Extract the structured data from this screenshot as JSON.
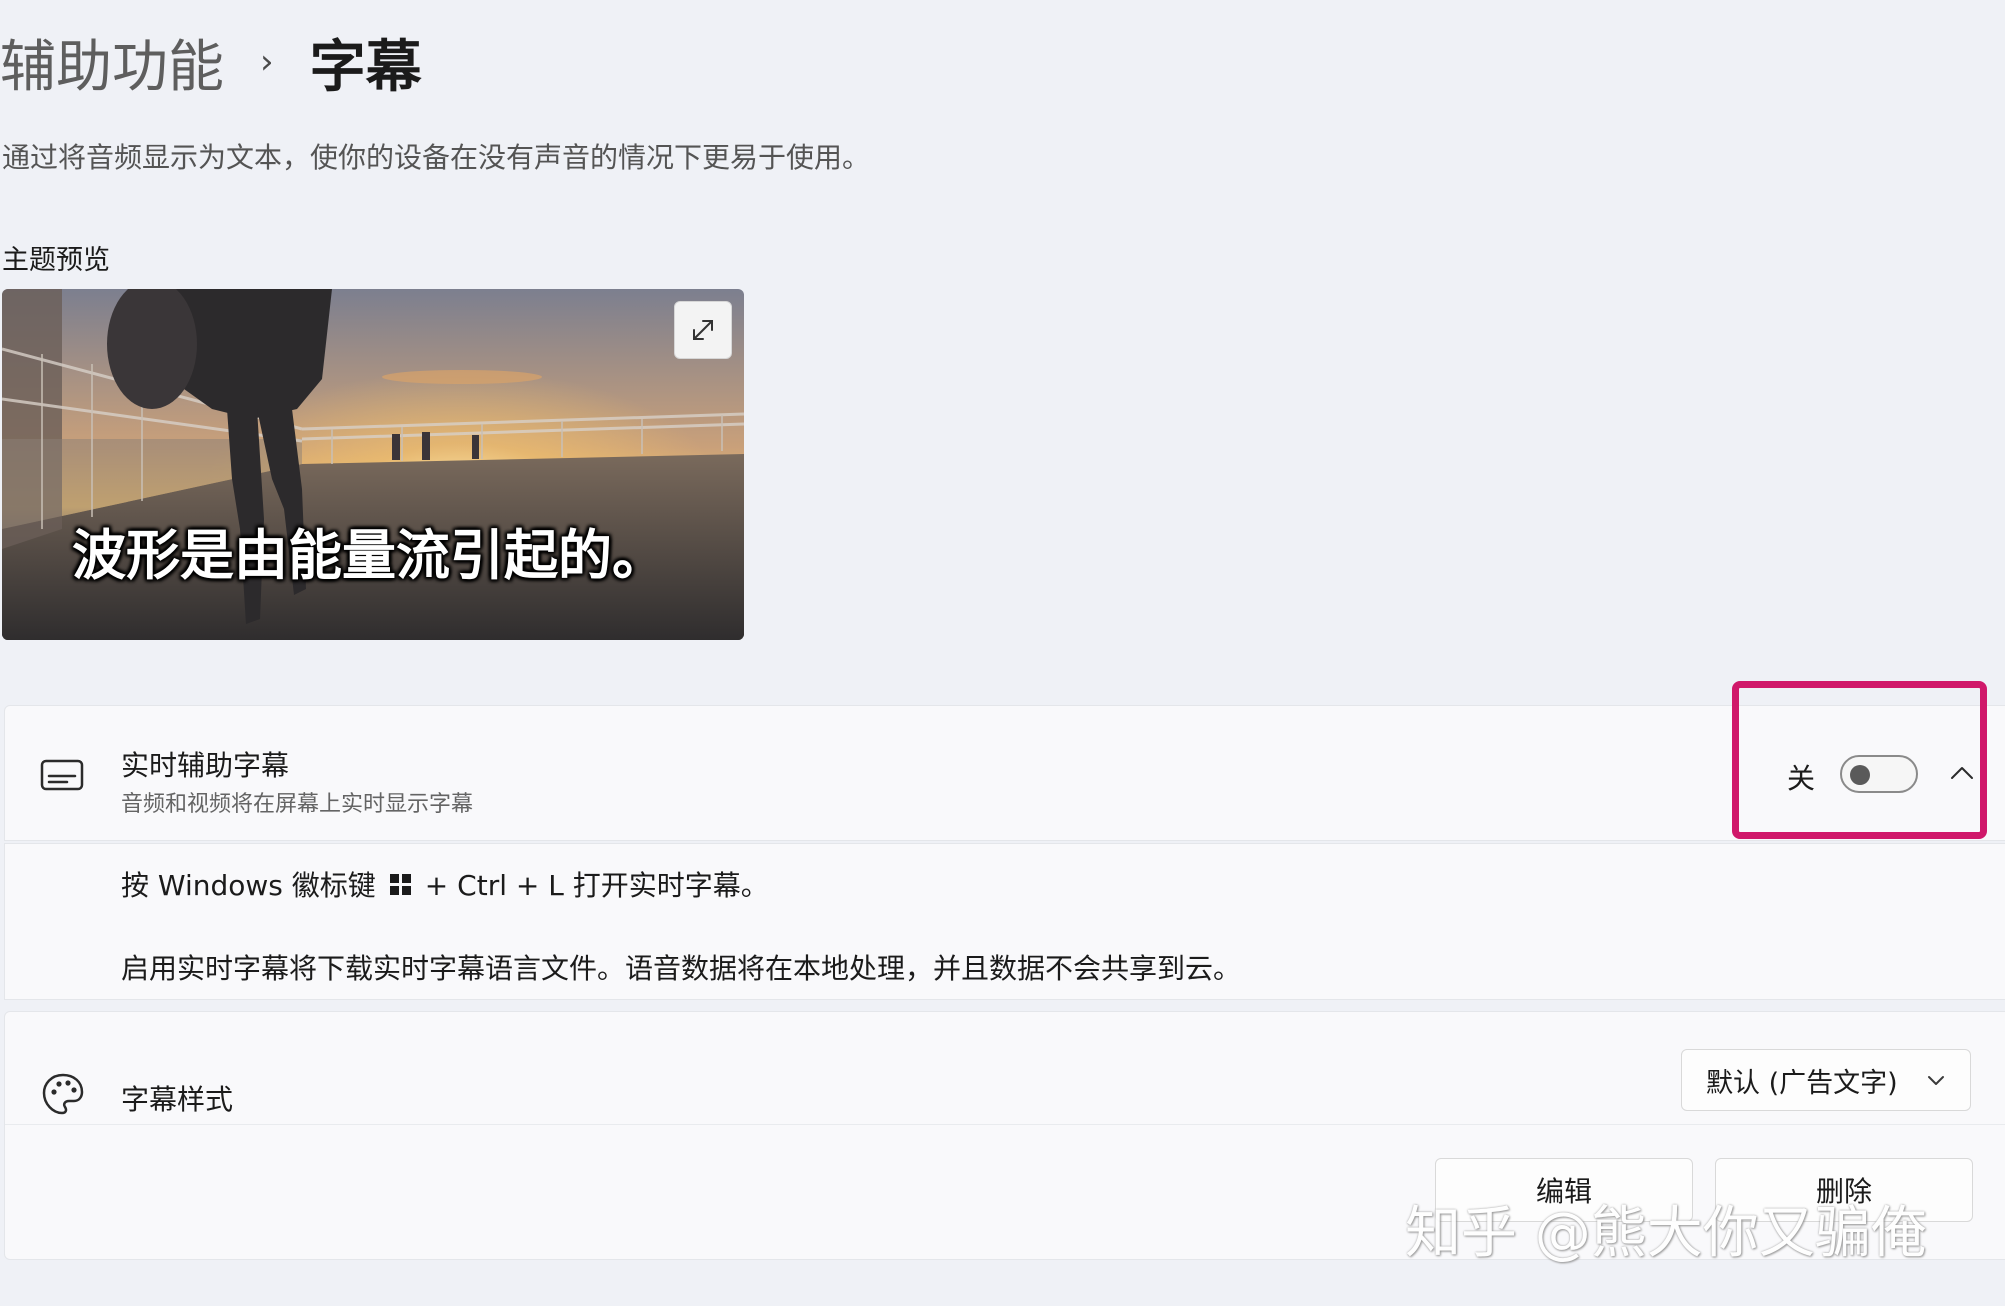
{
  "breadcrumb": {
    "parent": "辅助功能",
    "separator": "›",
    "current": "字幕"
  },
  "page_description": "通过将音频显示为文本，使你的设备在没有声音的情况下更易于使用。",
  "theme_preview": {
    "label": "主题预览",
    "caption_sample": "波形是由能量流引起的。",
    "expand_icon": "expand-icon"
  },
  "live_captions": {
    "icon": "captions-icon",
    "title": "实时辅助字幕",
    "subtitle": "音频和视频将在屏幕上实时显示字幕",
    "toggle_state_label": "关",
    "toggle_on": false,
    "expanded": true,
    "hint_prefix": "按 Windows 徽标键",
    "hint_suffix": "+ Ctrl + L 打开实时字幕。",
    "info": "启用实时字幕将下载实时字幕语言文件。语音数据将在本地处理，并且数据不会共享到云。"
  },
  "caption_style": {
    "icon": "palette-icon",
    "title": "字幕样式",
    "selected": "默认 (广告文字)",
    "edit_label": "编辑",
    "delete_label": "删除"
  },
  "highlight_color": "#d0186a",
  "watermark": "知乎 @熊大你又骗俺"
}
